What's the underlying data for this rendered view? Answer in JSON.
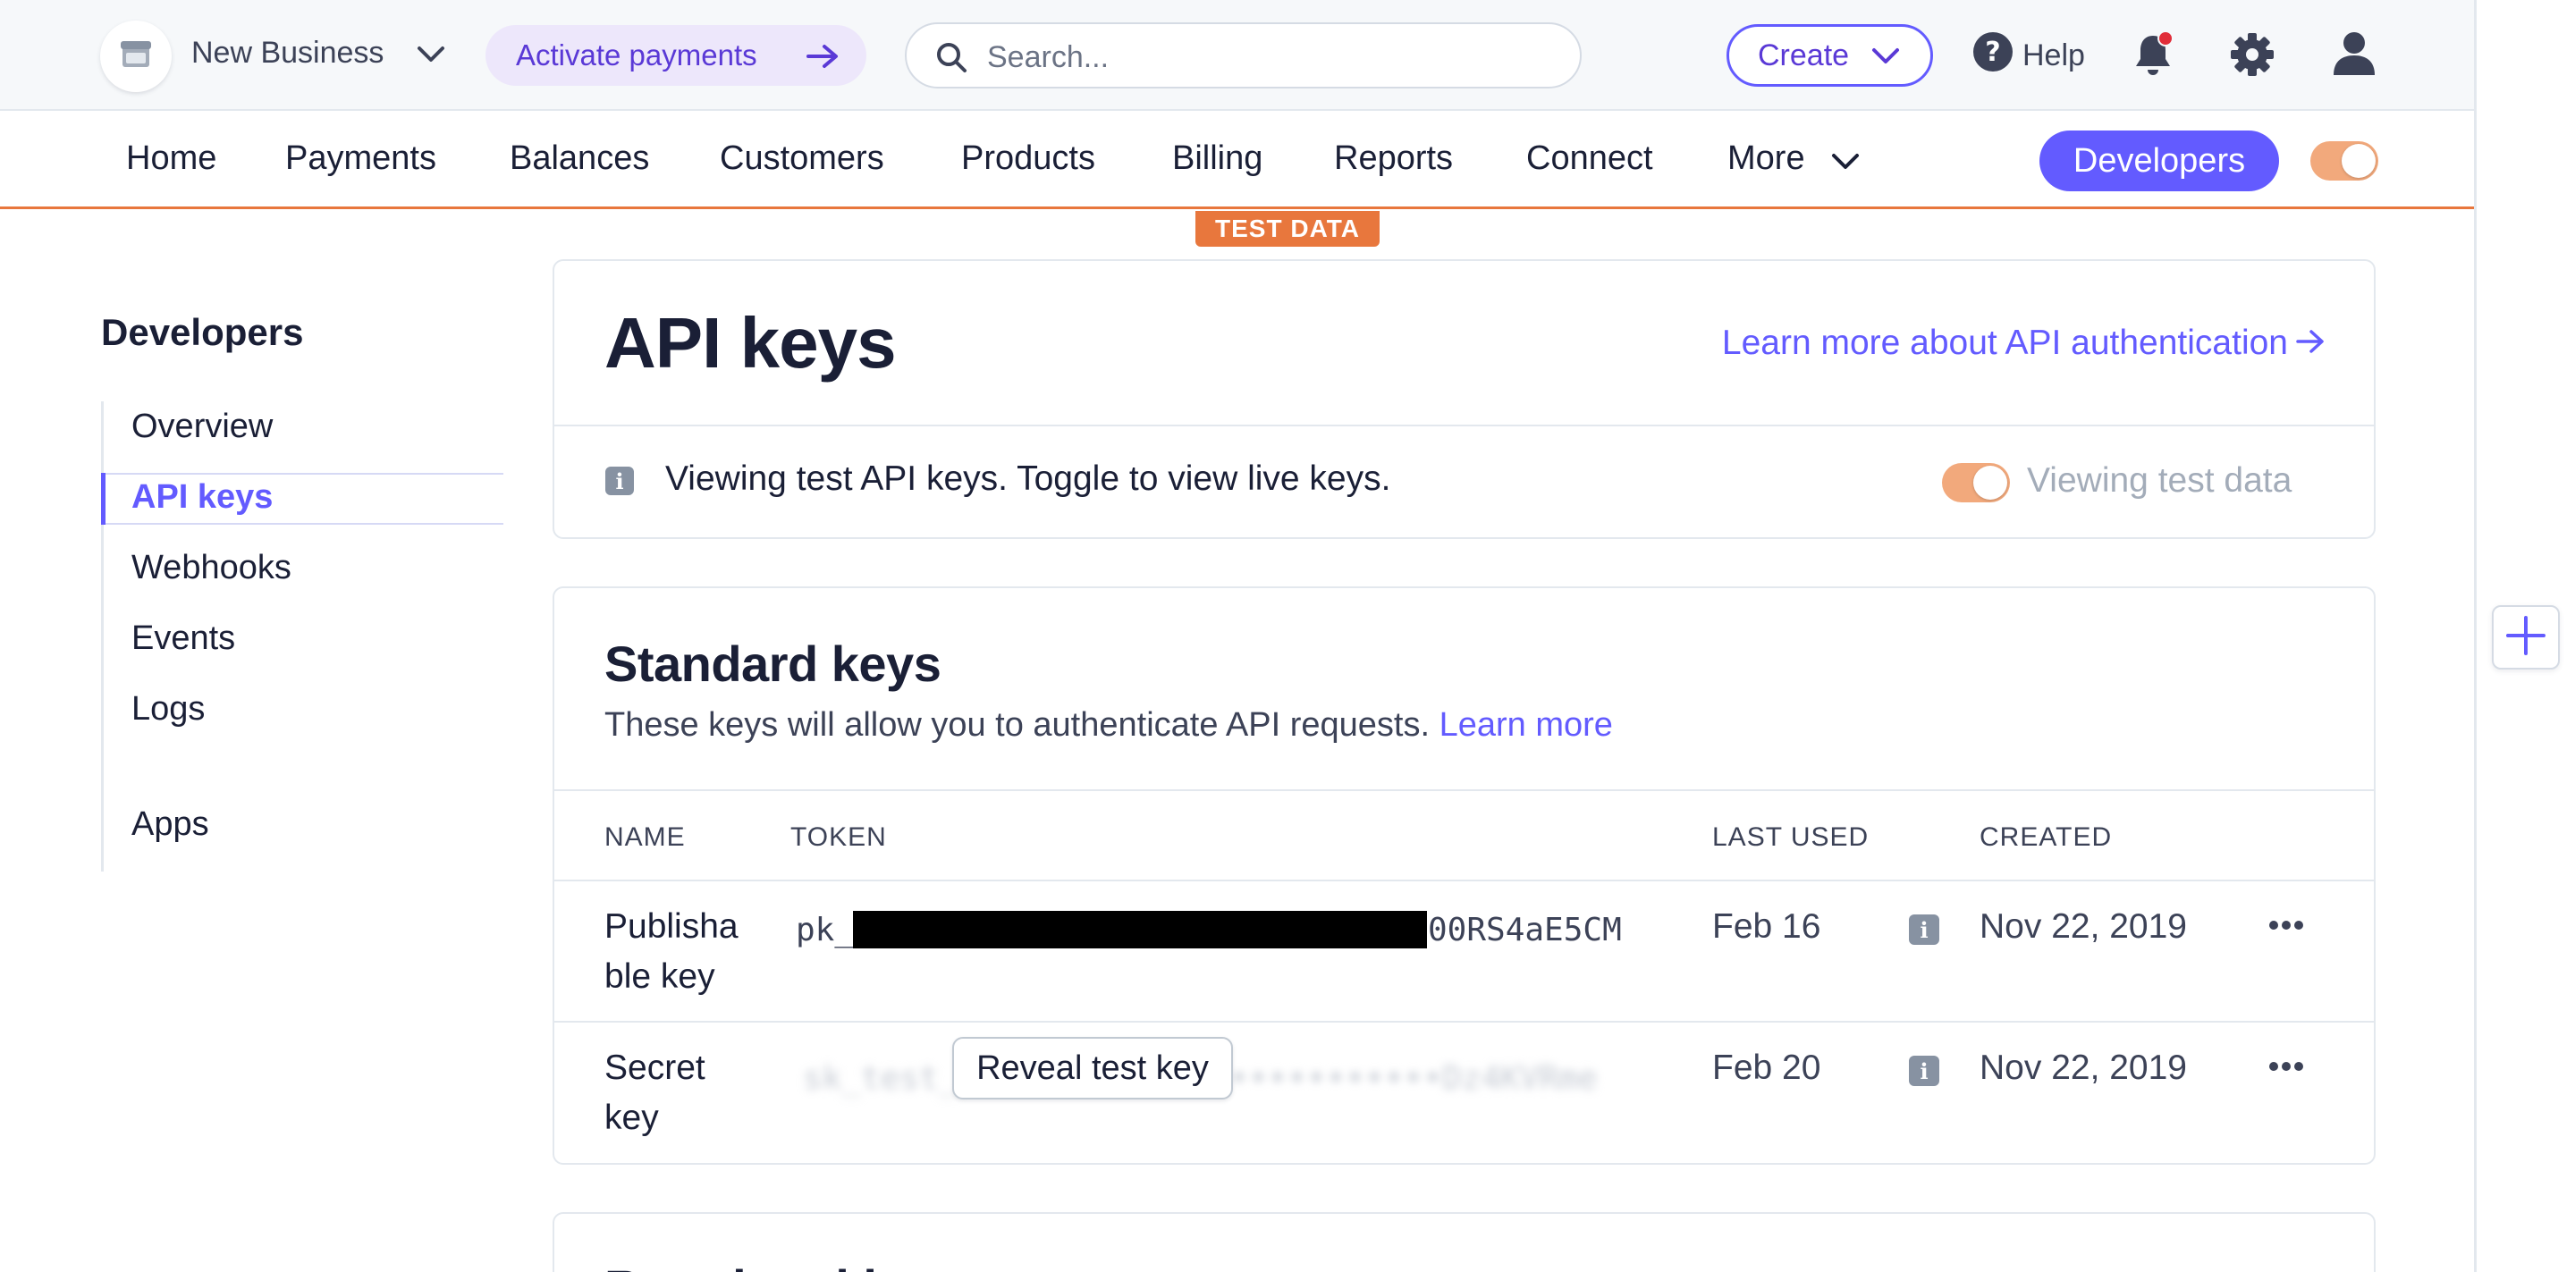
{
  "topbar": {
    "business_name": "New Business",
    "activate_label": "Activate payments",
    "search_placeholder": "Search...",
    "create_label": "Create",
    "help_label": "Help"
  },
  "nav": {
    "items": [
      "Home",
      "Payments",
      "Balances",
      "Customers",
      "Products",
      "Billing",
      "Reports",
      "Connect",
      "More"
    ],
    "developers_label": "Developers",
    "test_mode_badge": "TEST DATA"
  },
  "sidebar": {
    "title": "Developers",
    "items": [
      "Overview",
      "API keys",
      "Webhooks",
      "Events",
      "Logs",
      "Apps"
    ],
    "active": "API keys"
  },
  "header_card": {
    "title": "API keys",
    "learn_more": "Learn more about API authentication",
    "banner_text": "Viewing test API keys. Toggle to view live keys.",
    "toggle_label": "Viewing test data"
  },
  "standard_keys": {
    "title": "Standard keys",
    "subtitle": "These keys will allow you to authenticate API requests.",
    "subtitle_link": "Learn more",
    "columns": [
      "NAME",
      "TOKEN",
      "LAST USED",
      "CREATED"
    ],
    "rows": [
      {
        "name_line1": "Publisha",
        "name_line2": "ble key",
        "token_prefix": "pk_",
        "token_suffix": "00RS4aE5CM",
        "last_used": "Feb 16",
        "created": "Nov 22, 2019"
      },
      {
        "name_line1": "Secret",
        "name_line2": "key",
        "token_blurred": "sk_test_•••••••••••••••••••••••••Dz4KVRme",
        "reveal_label": "Reveal test key",
        "last_used": "Feb 20",
        "created": "Nov 22, 2019"
      }
    ]
  },
  "next_card": {
    "title": "Restricted keys"
  },
  "colors": {
    "accent": "#635bff",
    "test_orange": "#e8773d",
    "activate_bg": "#ede7fb",
    "notification_dot": "#e12d39"
  },
  "icons": [
    "store-icon",
    "chevron-down-icon",
    "arrow-right-icon",
    "search-icon",
    "help-icon",
    "bell-icon",
    "gear-icon",
    "user-icon",
    "info-icon",
    "more-horizontal-icon",
    "plus-icon"
  ]
}
